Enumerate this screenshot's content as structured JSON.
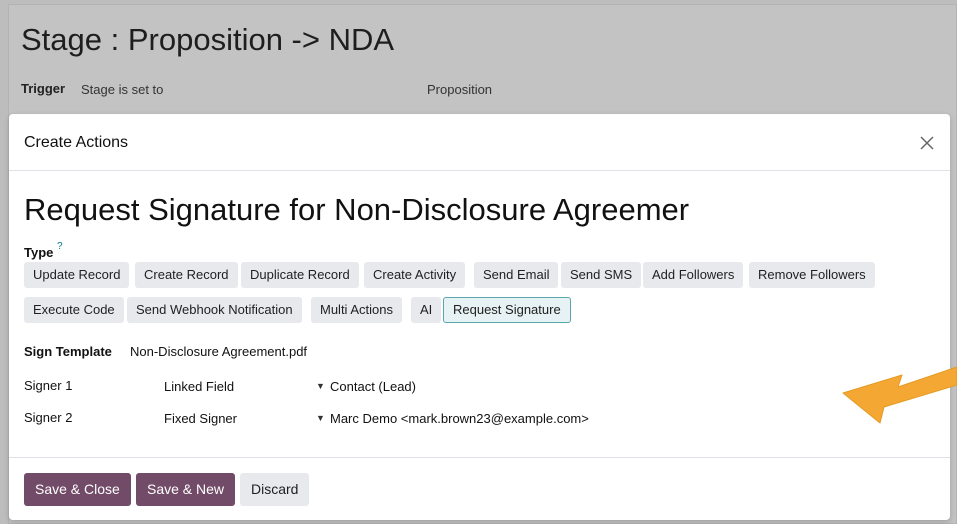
{
  "background": {
    "stage_title": "Stage : Proposition -> NDA",
    "trigger_label": "Trigger",
    "trigger_value": "Stage is set to",
    "trigger_stage": "Proposition"
  },
  "modal": {
    "title": "Create Actions",
    "close_icon": "close-icon",
    "record_title": "Request Signature for Non-Disclosure Agreemer",
    "type_label": "Type",
    "type_help": "?",
    "types_row1": [
      "Update Record",
      "Create Record",
      "Duplicate Record",
      "Create Activity",
      "Send Email",
      "Send SMS",
      "Add Followers",
      "Remove Followers"
    ],
    "types_row2": [
      "Execute Code",
      "Send Webhook Notification",
      "Multi Actions",
      "AI",
      "Request Signature"
    ],
    "selected_type": "Request Signature",
    "sign_template_label": "Sign Template",
    "sign_template_value": "Non-Disclosure Agreement.pdf",
    "signers": [
      {
        "label": "Signer 1",
        "type": "Linked Field",
        "value": "Contact (Lead)"
      },
      {
        "label": "Signer 2",
        "type": "Fixed Signer",
        "value": "Marc Demo <mark.brown23@example.com>"
      }
    ],
    "footer": {
      "save_close": "Save & Close",
      "save_new": "Save & New",
      "discard": "Discard"
    }
  },
  "colors": {
    "primary": "#714b67",
    "chip_bg": "#e7e9ed",
    "chip_active_border": "#5aa8ad",
    "arrow": "#f4a733"
  }
}
